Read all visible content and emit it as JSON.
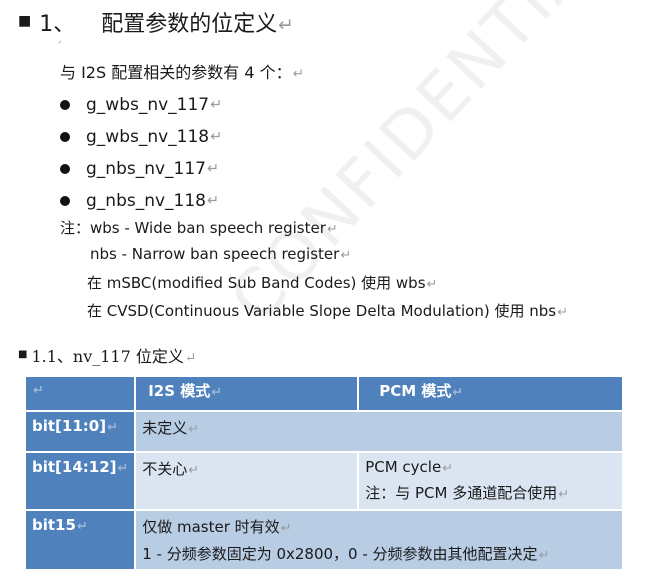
{
  "pilcrow": "↵",
  "heading": {
    "number": "1、",
    "title": "配置参数的位定义"
  },
  "intro": "与 I2S 配置相关的参数有 4 个：",
  "params": [
    "g_wbs_nv_117",
    "g_wbs_nv_118",
    "g_nbs_nv_117",
    "g_nbs_nv_118"
  ],
  "notes": [
    "注：wbs - Wide ban speech register",
    "nbs - Narrow ban speech register",
    "在 mSBC(modified Sub Band Codes) 使用 wbs",
    "在 CVSD(Continuous Variable Slope Delta Modulation) 使用 nbs"
  ],
  "subheading": "1.1、nv_117 位定义",
  "table": {
    "headers": {
      "col1": "I2S 模式",
      "col2": "PCM 模式"
    },
    "rows": [
      {
        "bits": "bit[11:0]",
        "i2s": "未定义"
      },
      {
        "bits": "bit[14:12]",
        "i2s": "不关心",
        "pcm": "PCM cycle",
        "pcm_note": "注：与 PCM 多通道配合使用"
      },
      {
        "bits": "bit15",
        "line1": "仅做 master 时有效",
        "line2": "1 - 分频参数固定为 0x2800，0 - 分频参数由其他配置决定"
      }
    ]
  },
  "watermark": "CONFIDENTIAL"
}
